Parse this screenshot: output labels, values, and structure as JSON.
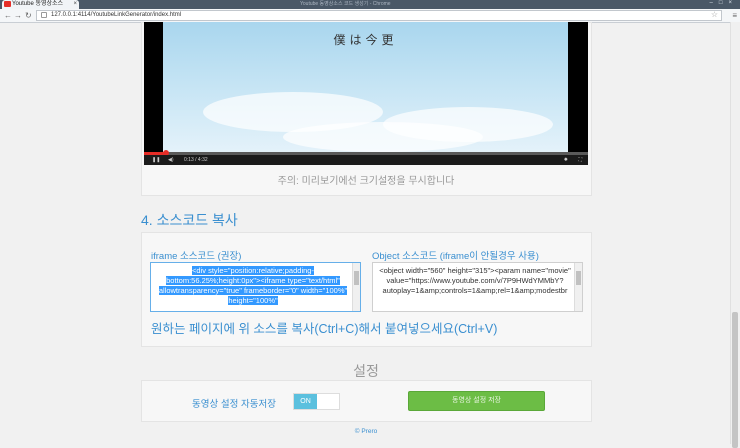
{
  "browser": {
    "tab_title": "Youtube 동영상소스",
    "window_title": "Youtube 동영상소스 코드 생성기 - Chrome",
    "url": "127.0.0.1:4114/YoutubeLinkGenerator/index.html"
  },
  "video": {
    "caption": "僕は今更",
    "time": "0:13 / 4:32",
    "progress_fraction": 0.05
  },
  "preview_notice": "주의: 미리보기에선 크기설정을 무시합니다",
  "section4": {
    "heading": "4. 소스코드 복사",
    "iframe_label": "iframe 소스코드 (권장)",
    "iframe_code": "<div style=\"position:relative;padding-bottom:56.25%;height:0px\"><iframe type=\"text/html\" allowtransparency=\"true\" frameborder=\"0\" width=\"100%\" height=\"100%\"",
    "object_label": "Object 소스코드 (iframe이 안될경우 사용)",
    "object_code": "<object width=\"560\" height=\"315\"><param name=\"movie\" value=\"https://www.youtube.com/v/7P9HWdYMMbY?autoplay=1&amp;controls=1&amp;rel=1&amp;modestbr",
    "copy_hint": "원하는 페이지에 위 소스를 복사(Ctrl+C)해서 붙여넣으세요(Ctrl+V)"
  },
  "settings": {
    "title": "설정",
    "autosave_label": "동영상 설정 자동저장",
    "toggle_state": "ON",
    "save_button": "동영상 설정 저장"
  },
  "footer": "© Prero",
  "colors": {
    "accent": "#3a8fd0",
    "button": "#6cbd45",
    "toggle_on": "#5bc0de"
  }
}
